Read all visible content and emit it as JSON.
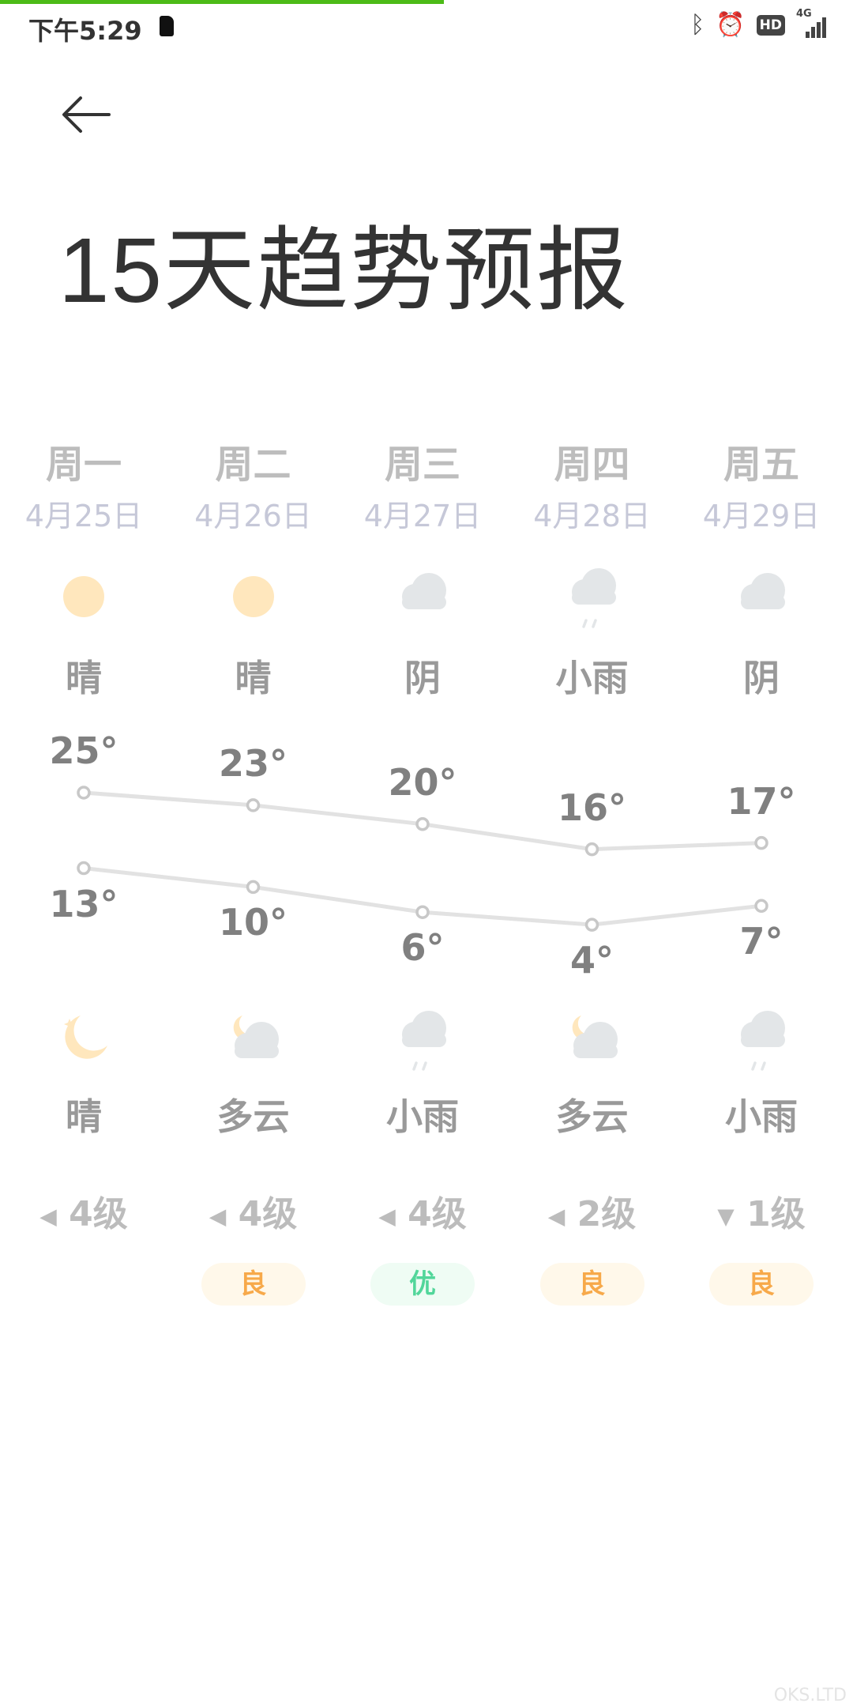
{
  "status_bar": {
    "time": "下午5:29",
    "page_load_progress": 0.52,
    "icons": [
      "sim-card-icon",
      "bluetooth-icon",
      "alarm-icon",
      "hd-icon",
      "4g-signal-icon"
    ],
    "network": "4G",
    "hd": "HD"
  },
  "header": {
    "back_icon": "arrow-left-icon",
    "title": "15天趋势预报"
  },
  "colors": {
    "sun": "#ffe7bd",
    "cloud": "#e3e6e8",
    "aqi_good": "#f7a94a",
    "aqi_good_bg": "#fff8ea",
    "aqi_excellent": "#52d69a",
    "aqi_excellent_bg": "#effcf4",
    "line": "#e2e2e2"
  },
  "days": [
    {
      "dow": "周一",
      "date": "4月25日",
      "day_icon": "sun",
      "day_cond": "晴",
      "high": "25°",
      "low": "13°",
      "night_icon": "moon",
      "night_cond": "晴",
      "wind_dir": "◀",
      "wind": "4级",
      "aqi": ""
    },
    {
      "dow": "周二",
      "date": "4月26日",
      "day_icon": "sun",
      "day_cond": "晴",
      "high": "23°",
      "low": "10°",
      "night_icon": "moon-cloud",
      "night_cond": "多云",
      "wind_dir": "◀",
      "wind": "4级",
      "aqi": "良",
      "aqi_level": "good"
    },
    {
      "dow": "周三",
      "date": "4月27日",
      "day_icon": "cloud",
      "day_cond": "阴",
      "high": "20°",
      "low": "6°",
      "night_icon": "rain",
      "night_cond": "小雨",
      "wind_dir": "◀",
      "wind": "4级",
      "aqi": "优",
      "aqi_level": "excellent"
    },
    {
      "dow": "周四",
      "date": "4月28日",
      "day_icon": "rain",
      "day_cond": "小雨",
      "high": "16°",
      "low": "4°",
      "night_icon": "moon-cloud",
      "night_cond": "多云",
      "wind_dir": "◀",
      "wind": "2级",
      "aqi": "良",
      "aqi_level": "good"
    },
    {
      "dow": "周五",
      "date": "4月29日",
      "day_icon": "cloud",
      "day_cond": "阴",
      "high": "17°",
      "low": "7°",
      "night_icon": "rain",
      "night_cond": "小雨",
      "wind_dir": "▼",
      "wind": "1级",
      "aqi": "良",
      "aqi_level": "good"
    }
  ],
  "chart_data": {
    "type": "line",
    "categories": [
      "4月25日",
      "4月26日",
      "4月27日",
      "4月28日",
      "4月29日"
    ],
    "series": [
      {
        "values": [
          25,
          23,
          20,
          16,
          17
        ]
      },
      {
        "values": [
          13,
          10,
          6,
          4,
          7
        ]
      }
    ]
  },
  "watermark": "OKS.LTD"
}
